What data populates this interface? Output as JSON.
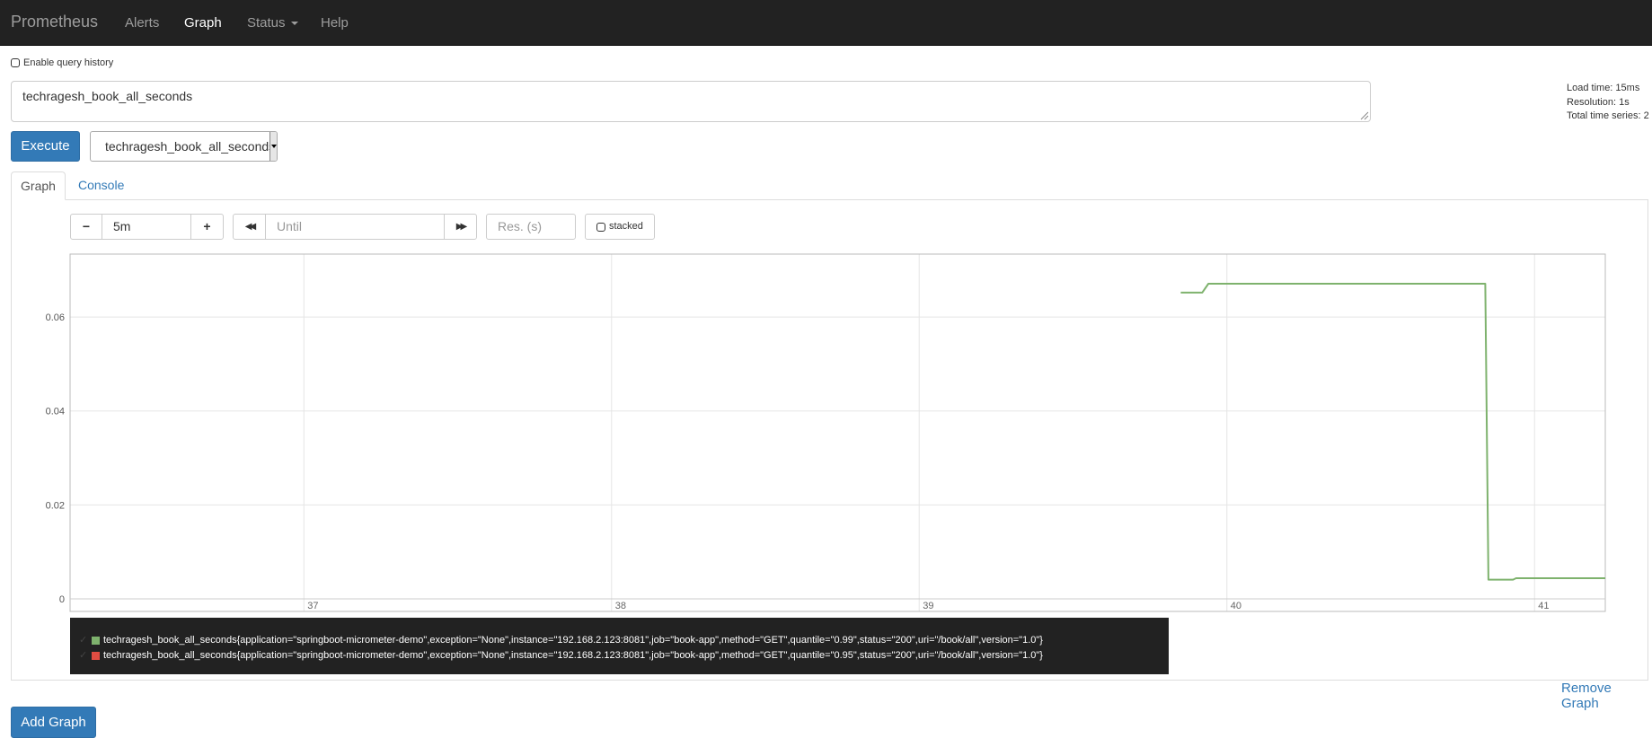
{
  "navbar": {
    "brand": "Prometheus",
    "items": [
      {
        "label": "Alerts"
      },
      {
        "label": "Graph"
      },
      {
        "label": "Status"
      },
      {
        "label": "Help"
      }
    ]
  },
  "query_history": {
    "label": "Enable query history",
    "checked": false
  },
  "expression": {
    "value": "techragesh_book_all_seconds"
  },
  "stats": {
    "load_time": "Load time: 15ms",
    "resolution": "Resolution: 1s",
    "total_series": "Total time series: 2"
  },
  "execute_label": "Execute",
  "metric_select": {
    "selected": "techragesh_book_all_seconds"
  },
  "tabs": [
    {
      "label": "Graph",
      "active": true
    },
    {
      "label": "Console",
      "active": false
    }
  ],
  "controls": {
    "minus": "−",
    "range": "5m",
    "plus": "+",
    "back": "◀◀",
    "until_placeholder": "Until",
    "forward": "▶▶",
    "res_placeholder": "Res. (s)",
    "stacked_label": "stacked"
  },
  "colors": {
    "accent": "#337ab7",
    "navbar": "#222222",
    "series_1": "#7eb26d",
    "series_2": "#e24d42"
  },
  "chart_data": {
    "type": "line",
    "xlabel": "",
    "ylabel": "",
    "xlim": [
      36.24,
      41.23
    ],
    "ylim": [
      0,
      0.0734
    ],
    "x_ticks": [
      37,
      38,
      39,
      40,
      41
    ],
    "y_ticks": [
      0,
      0.02,
      0.04,
      0.06
    ],
    "y_tick_labels": [
      "0",
      "0.02",
      "0.04",
      "0.06"
    ],
    "grid": true,
    "series": [
      {
        "name": "techragesh_book_all_seconds{application=\"springboot-micrometer-demo\",exception=\"None\",instance=\"192.168.2.123:8081\",job=\"book-app\",method=\"GET\",quantile=\"0.99\",status=\"200\",uri=\"/book/all\",version=\"1.0\"}",
        "color": "#7eb26d",
        "x": [
          39.85,
          39.92,
          39.94,
          40.84,
          40.85,
          40.93,
          40.94,
          41.23
        ],
        "y": [
          0.0652,
          0.0652,
          0.0671,
          0.0671,
          0.0041,
          0.0041,
          0.0044,
          0.0044
        ]
      },
      {
        "name": "techragesh_book_all_seconds{application=\"springboot-micrometer-demo\",exception=\"None\",instance=\"192.168.2.123:8081\",job=\"book-app\",method=\"GET\",quantile=\"0.95\",status=\"200\",uri=\"/book/all\",version=\"1.0\"}",
        "color": "#e24d42",
        "x": [],
        "y": []
      }
    ]
  },
  "remove_graph_label": "Remove Graph",
  "add_graph_label": "Add Graph"
}
